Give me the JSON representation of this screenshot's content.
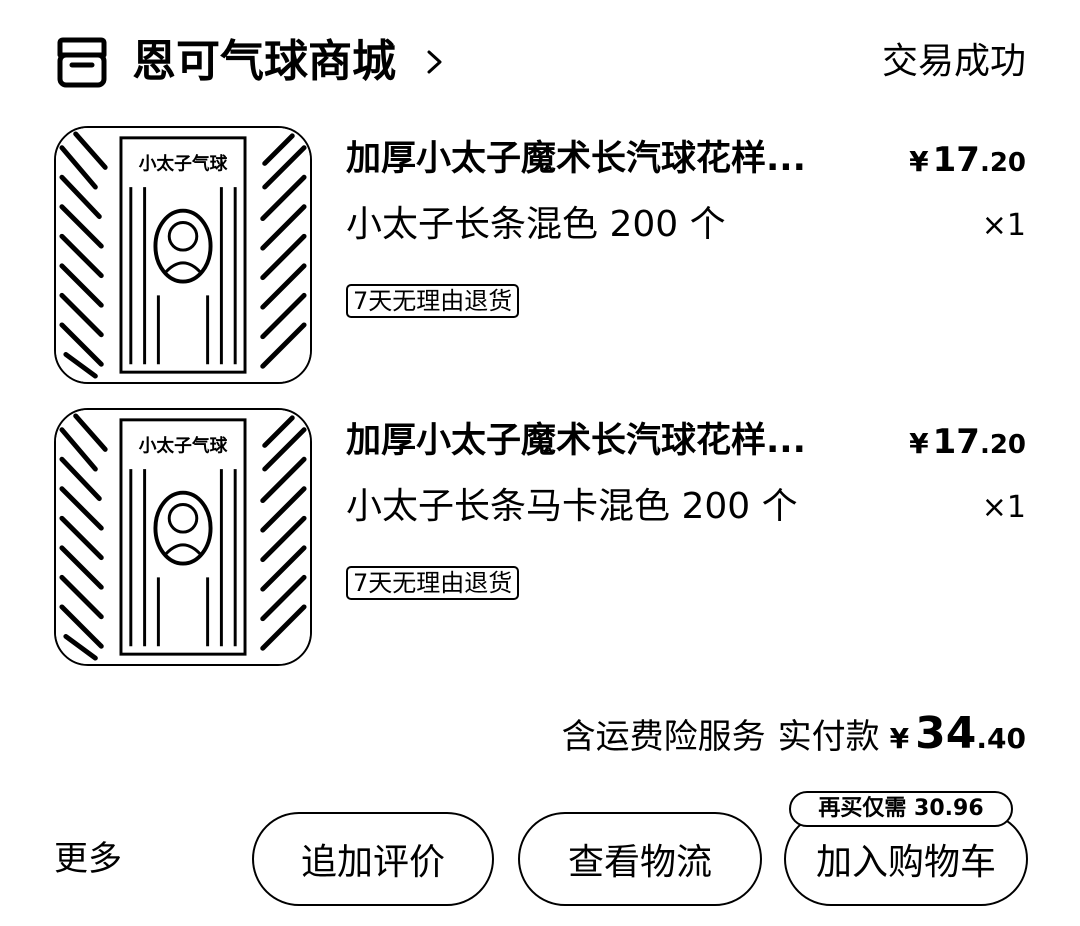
{
  "shop": {
    "name": "恩可气球商城",
    "icon": "store-icon",
    "chevron": "chevron-right-icon"
  },
  "order": {
    "status": "交易成功",
    "items": [
      {
        "title": "加厚小太子魔术长汽球花样...",
        "spec": "小太子长条混色 200 个",
        "price_currency": "¥",
        "price_int": "17",
        "price_dec": ".20",
        "quantity": "×1",
        "tag": "7天无理由退货",
        "package_brand_text": "小太子气球"
      },
      {
        "title": "加厚小太子魔术长汽球花样...",
        "spec": "小太子长条马卡混色 200 个",
        "price_currency": "¥",
        "price_int": "17",
        "price_dec": ".20",
        "quantity": "×1",
        "tag": "7天无理由退货",
        "package_brand_text": "小太子气球"
      }
    ],
    "total": {
      "note": "含运费险服务",
      "label": "实付款",
      "currency": "¥",
      "amount_int": "34",
      "amount_dec": ".40"
    }
  },
  "actions": {
    "more": "更多",
    "review": "追加评价",
    "logistics": "查看物流",
    "add_to_cart": "加入购物车",
    "cart_badge": "再买仅需 30.96"
  }
}
